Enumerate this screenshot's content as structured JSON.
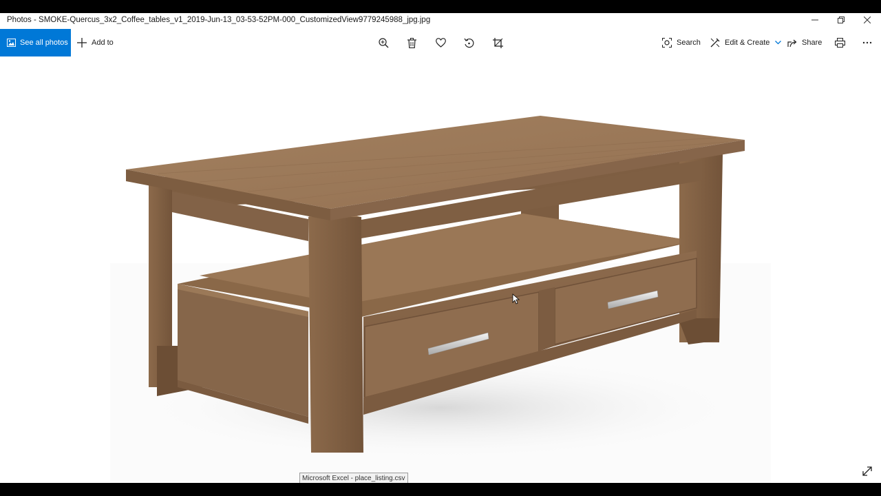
{
  "window": {
    "title": "Photos - SMOKE-Quercus_3x2_Coffee_tables_v1_2019-Jun-13_03-53-52PM-000_CustomizedView9779245988_jpg.jpg",
    "controls": {
      "minimize": "minimize-icon",
      "restore": "restore-icon",
      "close": "close-icon"
    }
  },
  "toolbar": {
    "see_all_label": "See all photos",
    "add_to_label": "Add to",
    "center_icons": [
      "zoom-in-icon",
      "delete-icon",
      "favorite-heart-icon",
      "rotate-icon",
      "crop-icon"
    ],
    "search_label": "Search",
    "edit_create_label": "Edit & Create",
    "share_label": "Share",
    "print_icon": "print-icon",
    "more_icon": "more-icon"
  },
  "viewer": {
    "image_subject": "wooden coffee table with two drawers",
    "tooltip": "Microsoft Excel - place_listing.csv",
    "expand_icon": "fullscreen-expand-icon"
  },
  "colors": {
    "accent": "#0078d7",
    "wood_light": "#a88463",
    "wood_mid": "#8c6a4c",
    "wood_dark": "#6e5038",
    "handle": "#d9d9d9"
  }
}
